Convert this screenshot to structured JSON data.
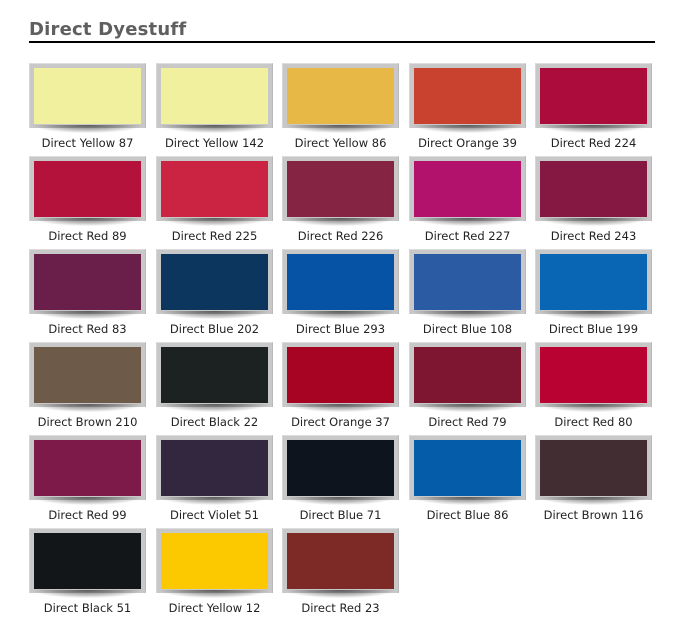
{
  "page": {
    "title": "Direct Dyestuff"
  },
  "swatches": [
    {
      "name": "Direct Yellow 87",
      "color": "#F1F09F"
    },
    {
      "name": "Direct Yellow 142",
      "color": "#F1F09F"
    },
    {
      "name": "Direct Yellow 86",
      "color": "#E8B846"
    },
    {
      "name": "Direct Orange 39",
      "color": "#C9412F"
    },
    {
      "name": "Direct Red 224",
      "color": "#AC0C3B"
    },
    {
      "name": "Direct Red 89",
      "color": "#B4123A"
    },
    {
      "name": "Direct Red 225",
      "color": "#CB2443"
    },
    {
      "name": "Direct Red 226",
      "color": "#862543"
    },
    {
      "name": "Direct Red 227",
      "color": "#B2126B"
    },
    {
      "name": "Direct Red 243",
      "color": "#841843"
    },
    {
      "name": "Direct Red 83",
      "color": "#6A1F4A"
    },
    {
      "name": "Direct Blue 202",
      "color": "#0D365F"
    },
    {
      "name": "Direct Blue 293",
      "color": "#0652A4"
    },
    {
      "name": "Direct Blue 108",
      "color": "#2B5BA3"
    },
    {
      "name": "Direct Blue 199",
      "color": "#0866B5"
    },
    {
      "name": "Direct Brown 210",
      "color": "#6E5A49"
    },
    {
      "name": "Direct Black 22",
      "color": "#1C2222"
    },
    {
      "name": "Direct Orange 37",
      "color": "#A60422"
    },
    {
      "name": "Direct Red 79",
      "color": "#7E1631"
    },
    {
      "name": "Direct Red 80",
      "color": "#B90232"
    },
    {
      "name": "Direct Red 99",
      "color": "#7E1A49"
    },
    {
      "name": "Direct Violet 51",
      "color": "#33273F"
    },
    {
      "name": "Direct Blue 71",
      "color": "#0E141E"
    },
    {
      "name": "Direct Blue 86",
      "color": "#055DA9"
    },
    {
      "name": "Direct Brown 116",
      "color": "#422D32"
    },
    {
      "name": "Direct Black 51",
      "color": "#121619"
    },
    {
      "name": "Direct Yellow 12",
      "color": "#FCC900"
    },
    {
      "name": "Direct Red 23",
      "color": "#7D2A26"
    }
  ]
}
